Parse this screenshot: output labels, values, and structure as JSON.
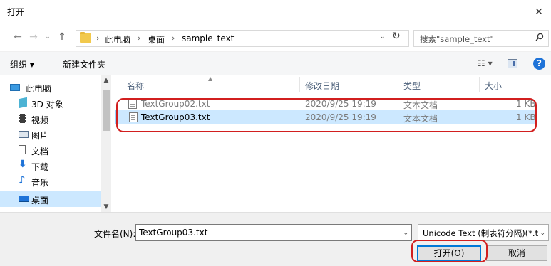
{
  "window": {
    "title": "打开",
    "close_glyph": "✕"
  },
  "nav": {
    "back_glyph": "←",
    "forward_glyph": "→",
    "history_glyph": "⌄",
    "up_glyph": "↑",
    "breadcrumb": [
      "此电脑",
      "桌面",
      "sample_text"
    ],
    "breadcrumb_sep": "›",
    "refresh_glyph": "↻",
    "search_placeholder": "搜索\"sample_text\""
  },
  "toolbar": {
    "organize": "组织 ▾",
    "new_folder": "新建文件夹",
    "view_glyph": "☷ ▾",
    "help": "?"
  },
  "sidebar": {
    "items": [
      {
        "label": "此电脑",
        "icon": "computer-icon"
      },
      {
        "label": "3D 对象",
        "icon": "3d-objects-icon"
      },
      {
        "label": "视频",
        "icon": "video-icon"
      },
      {
        "label": "图片",
        "icon": "pictures-icon"
      },
      {
        "label": "文档",
        "icon": "documents-icon"
      },
      {
        "label": "下载",
        "icon": "download-icon"
      },
      {
        "label": "音乐",
        "icon": "music-icon"
      },
      {
        "label": "桌面",
        "icon": "desktop-icon",
        "selected": true
      }
    ]
  },
  "filelist": {
    "columns": [
      "名称",
      "修改日期",
      "类型",
      "大小"
    ],
    "rows": [
      {
        "name": "TextGroup02.txt",
        "modified": "2020/9/25 19:19",
        "type": "文本文档",
        "size": "1 KB"
      },
      {
        "name": "TextGroup03.txt",
        "modified": "2020/9/25 19:19",
        "type": "文本文档",
        "size": "1 KB",
        "selected": true
      }
    ]
  },
  "footer": {
    "filename_label": "文件名(N):",
    "filename_value": "TextGroup03.txt",
    "filter_value": "Unicode Text (制表符分隔)(*.t",
    "open_button": "打开(O)",
    "cancel_button": "取消"
  },
  "colors": {
    "accent": "#0078d7",
    "selection": "#cce8ff",
    "annotation": "#d21f1f"
  }
}
